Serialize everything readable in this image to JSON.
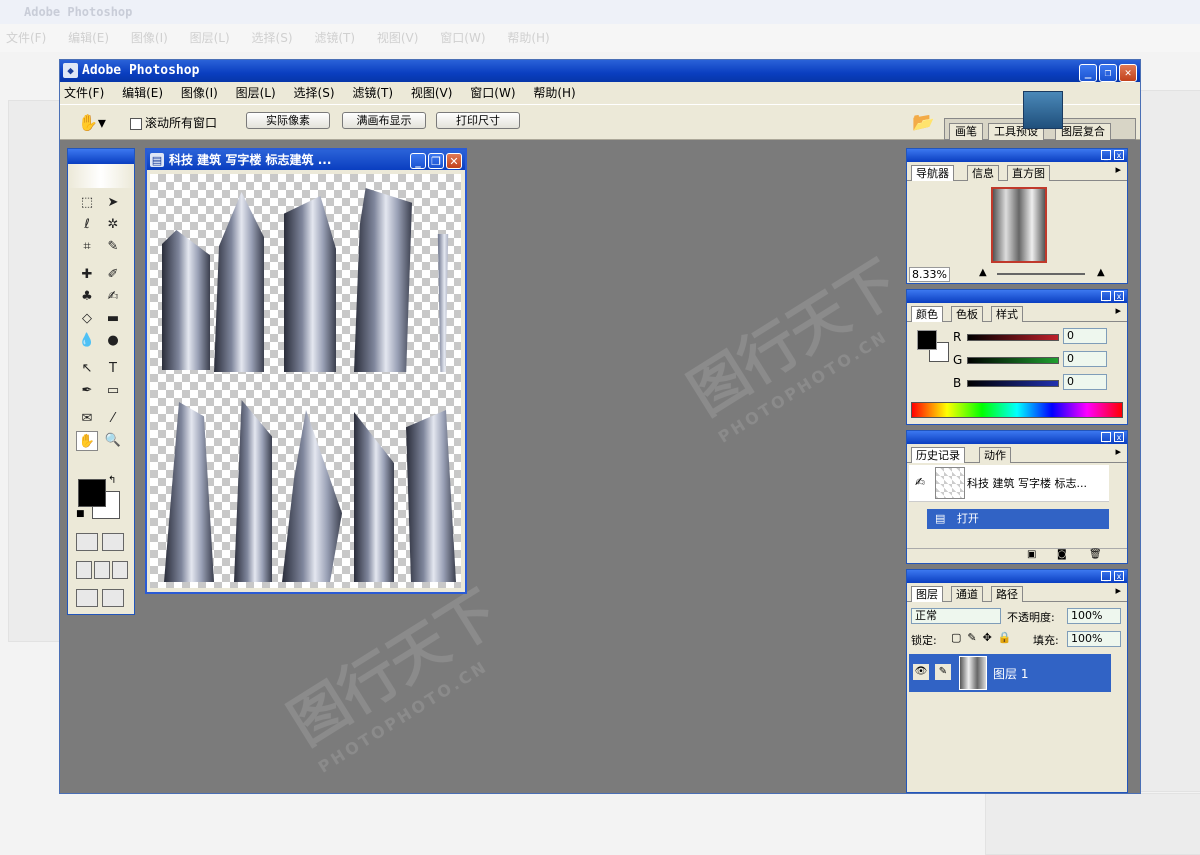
{
  "app_title": "Adobe Photoshop",
  "menu": [
    "文件(F)",
    "编辑(E)",
    "图像(I)",
    "图层(L)",
    "选择(S)",
    "滤镜(T)",
    "视图(V)",
    "窗口(W)",
    "帮助(H)"
  ],
  "options_bar": {
    "scroll_all": "滚动所有窗口",
    "actual_pixels": "实际像素",
    "fit_screen": "满画布显示",
    "print_size": "打印尺寸"
  },
  "palette_well_tabs": [
    "画笔",
    "工具预设",
    "图层复合"
  ],
  "document": {
    "title": "科技 建筑 写字楼 标志建筑 ..."
  },
  "navigator": {
    "tabs": [
      "导航器",
      "信息",
      "直方图"
    ],
    "zoom": "8.33%"
  },
  "color": {
    "tabs": [
      "颜色",
      "色板",
      "样式"
    ],
    "channels": [
      {
        "label": "R",
        "value": "0",
        "color": "#c0202a"
      },
      {
        "label": "G",
        "value": "0",
        "color": "#20a030"
      },
      {
        "label": "B",
        "value": "0",
        "color": "#2030b0"
      }
    ]
  },
  "history": {
    "tabs": [
      "历史记录",
      "动作"
    ],
    "snapshot_label": "科技 建筑 写字楼 标志...",
    "steps": [
      "打开"
    ]
  },
  "layers": {
    "tabs": [
      "图层",
      "通道",
      "路径"
    ],
    "blend_mode": "正常",
    "opacity_label": "不透明度:",
    "opacity": "100%",
    "lock_label": "锁定:",
    "fill_label": "填充:",
    "fill": "100%",
    "items": [
      "图层 1"
    ]
  },
  "watermark": {
    "text": "图行天下",
    "url": "PHOTOPHOTO.CN"
  },
  "colors": {
    "title_blue": "#0a3ec0",
    "panel_bg": "#ece9d8",
    "workspace": "#7b7b7b",
    "selection": "#3163c5"
  }
}
